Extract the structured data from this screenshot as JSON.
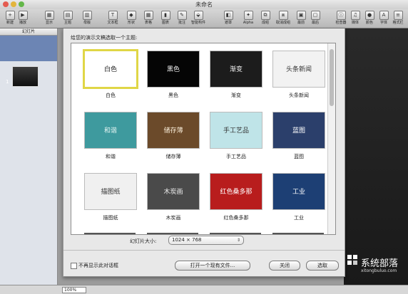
{
  "window": {
    "title": "未命名"
  },
  "toolbar": {
    "items": [
      {
        "label": "新建",
        "icon": "plus-icon",
        "glyph": "+"
      },
      {
        "label": "播放",
        "icon": "play-icon",
        "glyph": "▶"
      },
      {
        "label": "显示",
        "icon": "view-icon",
        "glyph": "▦"
      },
      {
        "label": "主题",
        "icon": "themes-icon",
        "glyph": "▤"
      },
      {
        "label": "母版",
        "icon": "masters-icon",
        "glyph": "▥"
      },
      {
        "label": "文本框",
        "icon": "textbox-icon",
        "glyph": "T"
      },
      {
        "label": "形状",
        "icon": "shapes-icon",
        "glyph": "◆"
      },
      {
        "label": "表格",
        "icon": "table-icon",
        "glyph": "▦"
      },
      {
        "label": "图表",
        "icon": "chart-icon",
        "glyph": "▮"
      },
      {
        "label": "批注",
        "icon": "comment-icon",
        "glyph": "✎"
      },
      {
        "label": "智能构件",
        "icon": "smart-build-icon",
        "glyph": "⬙"
      },
      {
        "label": "遮罩",
        "icon": "mask-icon",
        "glyph": "◧"
      },
      {
        "label": "Alpha",
        "icon": "alpha-icon",
        "glyph": "✦"
      },
      {
        "label": "成组",
        "icon": "group-icon",
        "glyph": "⧉"
      },
      {
        "label": "取消成组",
        "icon": "ungroup-icon",
        "glyph": "⧈"
      },
      {
        "label": "最前",
        "icon": "front-icon",
        "glyph": "▣"
      },
      {
        "label": "最后",
        "icon": "back-icon",
        "glyph": "▢"
      },
      {
        "label": "检查器",
        "icon": "inspector-icon",
        "glyph": "ⓘ"
      },
      {
        "label": "媒体",
        "icon": "media-icon",
        "glyph": "♫"
      },
      {
        "label": "颜色",
        "icon": "colors-icon",
        "glyph": "●"
      },
      {
        "label": "字体",
        "icon": "fonts-icon",
        "glyph": "A"
      },
      {
        "label": "格式栏",
        "icon": "format-bar-icon",
        "glyph": "≡"
      }
    ]
  },
  "sidebar": {
    "header": "幻灯片",
    "slide_number": "1"
  },
  "status": {
    "zoom": "100%"
  },
  "dialog": {
    "prompt": "给您的演示文稿选取一个主题:",
    "themes": [
      {
        "name": "白色",
        "label": "白色",
        "bg": "#ffffff",
        "fg": "#222222"
      },
      {
        "name": "黑色",
        "label": "黑色",
        "bg": "#050505",
        "fg": "#eeeeee"
      },
      {
        "name": "渐变",
        "label": "渐变",
        "bg": "#1c1c1c",
        "fg": "#f0f0f0"
      },
      {
        "name": "头条新闻",
        "label": "头条新闻",
        "bg": "#f2f2f2",
        "fg": "#333333"
      },
      {
        "name": "和谐",
        "label": "和谐",
        "bg": "#3e9a9e",
        "fg": "#e6f5f3"
      },
      {
        "name": "储存薄",
        "label": "储存薄",
        "bg": "#6b4a2a",
        "fg": "#f5e9d4"
      },
      {
        "name": "手工艺品",
        "label": "手工艺品",
        "bg": "#bfe4e8",
        "fg": "#333333"
      },
      {
        "name": "蓝图",
        "label": "蓝图",
        "bg": "#2b3f6b",
        "fg": "#ffffff"
      },
      {
        "name": "描图纸",
        "label": "描图纸",
        "bg": "#f0f0f0",
        "fg": "#333333"
      },
      {
        "name": "木炭画",
        "label": "木炭画",
        "bg": "#4a4a4a",
        "fg": "#eeeeee"
      },
      {
        "name": "红色桑多那",
        "label": "红色桑多那",
        "bg": "#b81d1d",
        "fg": "#ffffff"
      },
      {
        "name": "工业",
        "label": "工业",
        "bg": "#1d3f74",
        "fg": "#ffffff"
      }
    ],
    "slide_size_label": "幻灯片大小:",
    "slide_size_value": "1024 × 768",
    "dont_show_label": "不再显示此对话框",
    "open_existing_label": "打开一个现有文件...",
    "close_label": "关闭",
    "choose_label": "选取"
  },
  "watermark": {
    "text": "系统部落",
    "url": "xitongbuluo.com"
  }
}
